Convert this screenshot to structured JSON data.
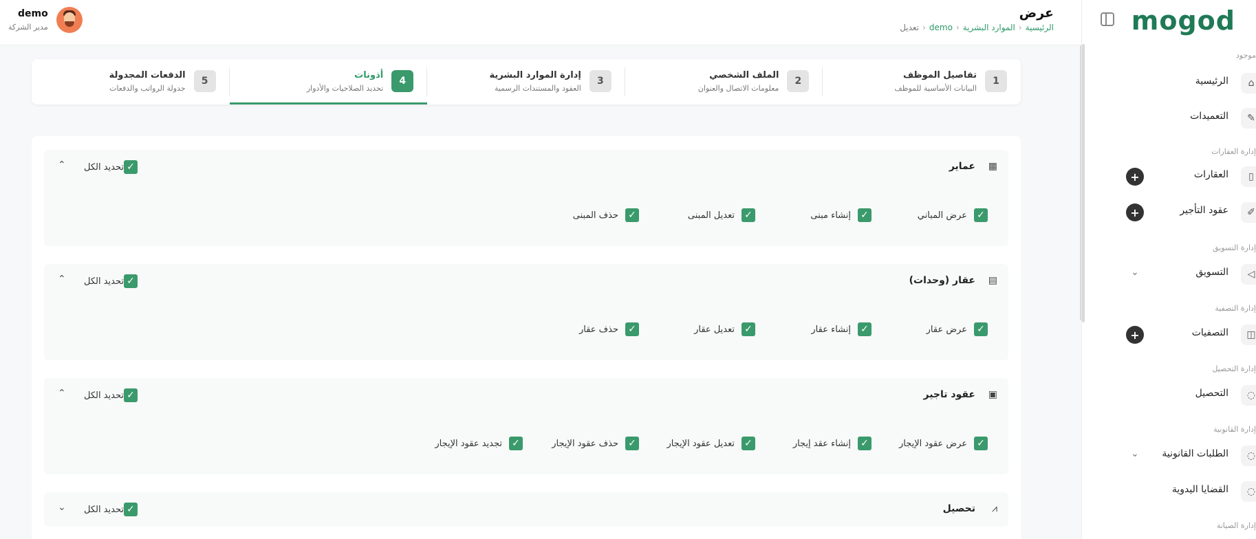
{
  "sidebar": {
    "logo": "mogod",
    "items": [
      {
        "type": "section",
        "label": "موجود"
      },
      {
        "type": "item",
        "label": "الرئيسية",
        "icon": "home-icon",
        "glyph": "⌂"
      },
      {
        "type": "item",
        "label": "التعميدات",
        "icon": "stamp-icon",
        "glyph": "✎"
      },
      {
        "type": "section",
        "label": "إدارة العقارات"
      },
      {
        "type": "item",
        "label": "العقارات",
        "icon": "building-icon",
        "glyph": "▯",
        "plus": true
      },
      {
        "type": "item",
        "label": "عقود التأجير",
        "icon": "contract-icon",
        "glyph": "✐",
        "plus": true
      },
      {
        "type": "section",
        "label": "إدارة التسويق"
      },
      {
        "type": "item",
        "label": "التسويق",
        "icon": "megaphone-icon",
        "glyph": "◁",
        "chevron": true
      },
      {
        "type": "section",
        "label": "إدارة التصفية"
      },
      {
        "type": "item",
        "label": "التصفيات",
        "icon": "wallet-icon",
        "glyph": "◫",
        "plus": true
      },
      {
        "type": "section",
        "label": "إدارة التحصيل"
      },
      {
        "type": "item",
        "label": "التحصيل",
        "icon": "collection-icon",
        "glyph": "◌"
      },
      {
        "type": "section",
        "label": "إدارة القانونية"
      },
      {
        "type": "item",
        "label": "الطلبات القانونية",
        "icon": "legal-icon",
        "glyph": "◌",
        "chevron": true
      },
      {
        "type": "item",
        "label": "القضايا اليدوية",
        "icon": "case-icon",
        "glyph": "◌"
      },
      {
        "type": "section",
        "label": "إدارة الصيانة"
      }
    ]
  },
  "header": {
    "title": "عرض",
    "breadcrumb": [
      "الرئيسية",
      "الموارد البشرية",
      "demo",
      "تعديل"
    ],
    "user_name": "demo",
    "user_role": "مدير الشركة"
  },
  "stepper": [
    {
      "num": "1",
      "title": "تفاصيل الموظف",
      "subtitle": "البيانات الأساسية للموظف",
      "active": false
    },
    {
      "num": "2",
      "title": "الملف الشخصي",
      "subtitle": "معلومات الاتصال والعنوان",
      "active": false
    },
    {
      "num": "3",
      "title": "إدارة الموارد البشرية",
      "subtitle": "العقود والمستندات الرسمية",
      "active": false
    },
    {
      "num": "4",
      "title": "أذونات",
      "subtitle": "تحديد الصلاحيات والأدوار",
      "active": true
    },
    {
      "num": "5",
      "title": "الدفعات المجدولة",
      "subtitle": "جدولة الرواتب والدفعات",
      "active": false
    }
  ],
  "permissions": {
    "select_all_label": "تحديد الكل",
    "groups": [
      {
        "title": "عماير",
        "icon": "building-icon",
        "glyph": "▦",
        "expanded": true,
        "perms": [
          "عرض المباني",
          "إنشاء مبنى",
          "تعديل المبنى",
          "حذف المبنى"
        ]
      },
      {
        "title": "عقار (وحدات)",
        "icon": "document-icon",
        "glyph": "▤",
        "expanded": true,
        "perms": [
          "عرض عقار",
          "إنشاء عقار",
          "تعديل عقار",
          "حذف عقار"
        ]
      },
      {
        "title": "عقود تاجير",
        "icon": "money-icon",
        "glyph": "▣",
        "expanded": true,
        "perms": [
          "عرض عقود الإيجار",
          "إنشاء عقد إيجار",
          "تعديل عقود الإيجار",
          "حذف عقود الإيجار",
          "تجديد عقود الإيجار"
        ]
      },
      {
        "title": "تحصيل",
        "icon": "chart-icon",
        "glyph": "⩘",
        "expanded": false,
        "perms": []
      }
    ]
  },
  "colors": {
    "accent": "#3a9a6c",
    "link": "#2e9a6a",
    "dark": "#333333"
  }
}
